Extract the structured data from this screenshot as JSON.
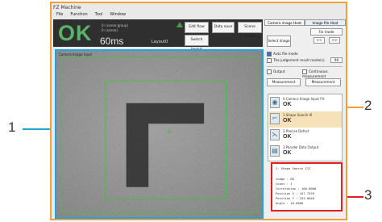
{
  "callouts": {
    "c1": "1",
    "c2": "2",
    "c3": "3"
  },
  "colors": {
    "frame": "#f3a03a",
    "image_pane": "#1aa6e0",
    "result_pane": "#e02020",
    "ok_green": "#59b36a"
  },
  "window": {
    "title": "FZ Machine"
  },
  "menu": [
    "File",
    "Function",
    "Tool",
    "Window"
  ],
  "header": {
    "status": "OK",
    "info1": "0: (scene group)",
    "info2": "0: (scene)",
    "time": "60ms",
    "layout_label": "Layout0",
    "btn_edit_flow": "Edit flow",
    "btn_data_save": "Data save",
    "btn_scene_switch": "Scene switch",
    "btn_switch_layout": "Switch layout"
  },
  "image_pane": {
    "label": "Camera Image Input"
  },
  "right_panel": {
    "tab_camera": "Camera image Heat",
    "tab_image_file": "Image file Heat",
    "select_image": "Select image",
    "fix_mode": "Fix mode",
    "auto_mode": "Auto file mode",
    "judgement_mode": "The judgement result mode(s)",
    "judgement_value": "99",
    "output": "Output",
    "continuous": "Continuous measurement",
    "measure_btn": "Measurement"
  },
  "list": [
    {
      "icon": "camera-icon",
      "title": "0.Camera Image Input FH",
      "status": "OK"
    },
    {
      "icon": "shape-search-icon",
      "title": "1.Shape Search III",
      "status": "OK"
    },
    {
      "icon": "precise-defect-icon",
      "title": "2.Precise Defect",
      "status": "OK"
    },
    {
      "icon": "output-icon",
      "title": "3.Parallel Data Output",
      "status": "OK"
    }
  ],
  "result_lines": [
    "1. Shape Search III",
    "",
    "Judge : OK",
    "Count : 1",
    "Correlation : 100.0000",
    "Position X : 347.7539",
    "Position Y : 253.0046",
    "Angle : 10.0000"
  ]
}
